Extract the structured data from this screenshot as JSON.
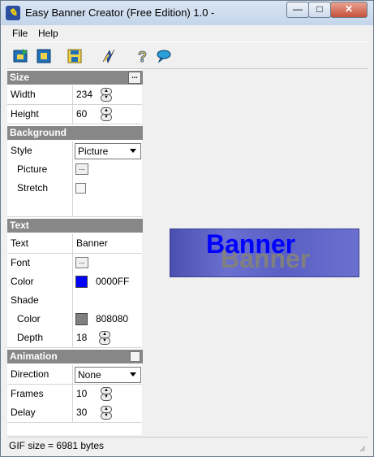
{
  "window": {
    "title": "Easy Banner Creator (Free Edition) 1.0 -",
    "app_icon": "pen-icon"
  },
  "window_controls": {
    "minimize": "—",
    "maximize": "□",
    "close": "✕"
  },
  "menu": {
    "items": [
      "File",
      "Help"
    ]
  },
  "toolbar": {
    "buttons": [
      "open-icon",
      "new-icon",
      "save-icon",
      "generate-icon",
      "help-icon",
      "feedback-icon"
    ]
  },
  "size": {
    "header": "Size",
    "header_button": "...",
    "width": {
      "label": "Width",
      "value": "234"
    },
    "height": {
      "label": "Height",
      "value": "60"
    }
  },
  "background": {
    "header": "Background",
    "style": {
      "label": "Style",
      "value": "Picture"
    },
    "picture": {
      "label": "Picture",
      "button": "..."
    },
    "stretch": {
      "label": "Stretch",
      "checked": false
    }
  },
  "text": {
    "header": "Text",
    "text": {
      "label": "Text",
      "value": "Banner"
    },
    "font": {
      "label": "Font",
      "button": "..."
    },
    "color": {
      "label": "Color",
      "value": "0000FF",
      "swatch": "#0000FF"
    },
    "shade": {
      "label": "Shade"
    },
    "shade_color": {
      "label": "Color",
      "value": "808080",
      "swatch": "#808080"
    },
    "depth": {
      "label": "Depth",
      "value": "18"
    }
  },
  "animation": {
    "header": "Animation",
    "enabled": false,
    "direction": {
      "label": "Direction",
      "value": "None"
    },
    "frames": {
      "label": "Frames",
      "value": "10"
    },
    "delay": {
      "label": "Delay",
      "value": "30"
    }
  },
  "preview": {
    "text": "Banner",
    "text_color": "#0000FF",
    "shade_color": "#808080"
  },
  "status": {
    "text": "GIF size = 6981 bytes"
  }
}
